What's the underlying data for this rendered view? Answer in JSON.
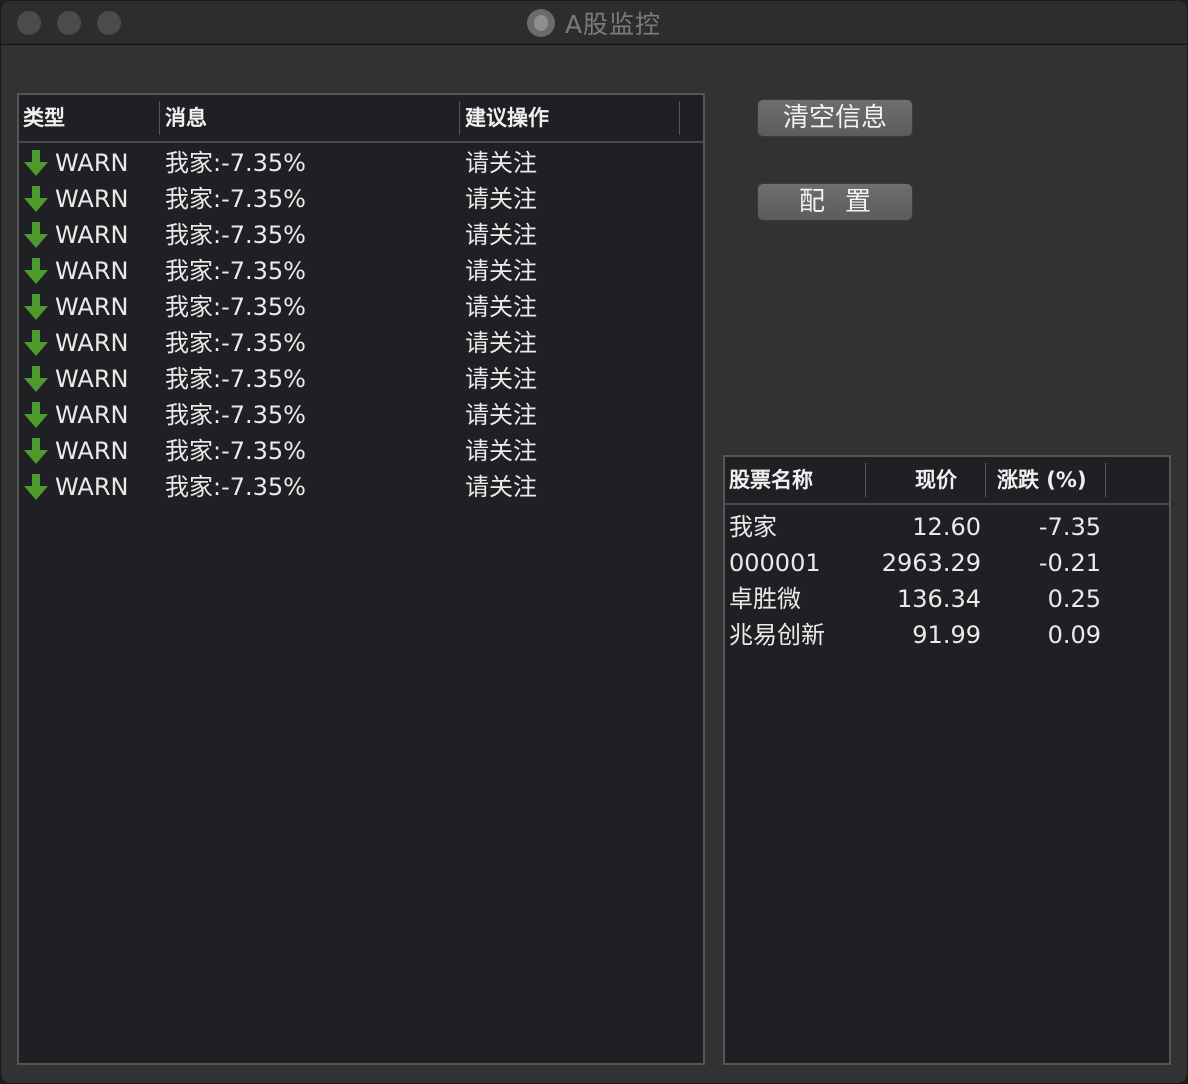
{
  "window": {
    "title": "A股监控"
  },
  "buttons": {
    "clear_label": "清空信息",
    "config_label": "配置"
  },
  "alerts_table": {
    "headers": {
      "type": "类型",
      "message": "消息",
      "action": "建议操作"
    },
    "rows": [
      {
        "icon": "down-arrow-icon",
        "type": "WARN",
        "message": "我家:-7.35%",
        "action": "请关注"
      },
      {
        "icon": "down-arrow-icon",
        "type": "WARN",
        "message": "我家:-7.35%",
        "action": "请关注"
      },
      {
        "icon": "down-arrow-icon",
        "type": "WARN",
        "message": "我家:-7.35%",
        "action": "请关注"
      },
      {
        "icon": "down-arrow-icon",
        "type": "WARN",
        "message": "我家:-7.35%",
        "action": "请关注"
      },
      {
        "icon": "down-arrow-icon",
        "type": "WARN",
        "message": "我家:-7.35%",
        "action": "请关注"
      },
      {
        "icon": "down-arrow-icon",
        "type": "WARN",
        "message": "我家:-7.35%",
        "action": "请关注"
      },
      {
        "icon": "down-arrow-icon",
        "type": "WARN",
        "message": "我家:-7.35%",
        "action": "请关注"
      },
      {
        "icon": "down-arrow-icon",
        "type": "WARN",
        "message": "我家:-7.35%",
        "action": "请关注"
      },
      {
        "icon": "down-arrow-icon",
        "type": "WARN",
        "message": "我家:-7.35%",
        "action": "请关注"
      },
      {
        "icon": "down-arrow-icon",
        "type": "WARN",
        "message": "我家:-7.35%",
        "action": "请关注"
      }
    ]
  },
  "stocks_table": {
    "headers": {
      "name": "股票名称",
      "price": "现价",
      "change": "涨跌 (%)"
    },
    "rows": [
      {
        "name": "我家",
        "price": "12.60",
        "change": "-7.35"
      },
      {
        "name": "000001",
        "price": "2963.29",
        "change": "-0.21"
      },
      {
        "name": "卓胜微",
        "price": "136.34",
        "change": "0.25"
      },
      {
        "name": "兆易创新",
        "price": "91.99",
        "change": "0.09"
      }
    ]
  },
  "colors": {
    "arrow_green": "#4f9a2e",
    "panel_bg": "#1f2023",
    "window_bg": "#323232"
  }
}
